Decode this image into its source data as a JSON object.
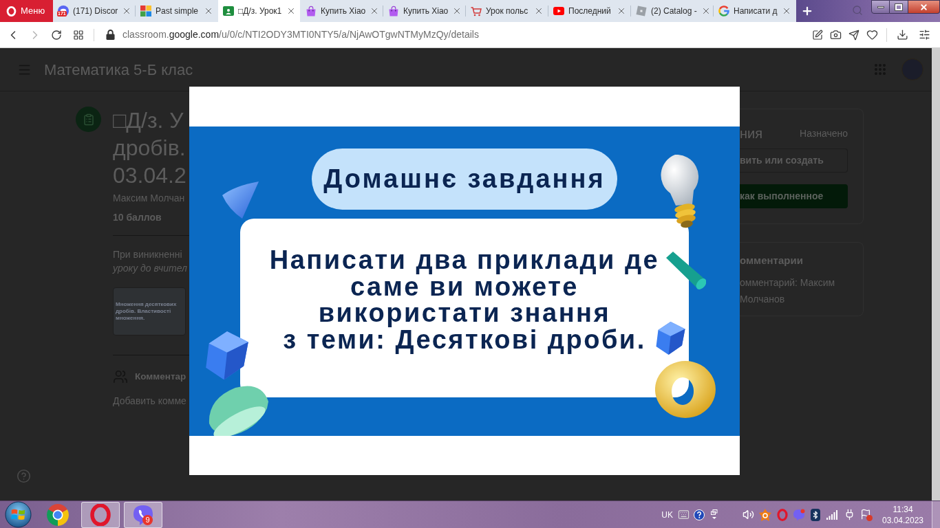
{
  "browser": {
    "menu_label": "Меню",
    "tabs": [
      {
        "kind": "chat",
        "badge": "171",
        "title": "(171) Discor",
        "selected": false
      },
      {
        "kind": "blocks",
        "title": "Past simple",
        "selected": false
      },
      {
        "kind": "board",
        "title": "□Д/з. Урок1",
        "selected": true
      },
      {
        "kind": "bag",
        "title": "Купить Xiao",
        "selected": false
      },
      {
        "kind": "bag",
        "title": "Купить Xiao",
        "selected": false
      },
      {
        "kind": "cart",
        "title": "Урок польс",
        "selected": false
      },
      {
        "kind": "play",
        "title": "Последний",
        "selected": false
      },
      {
        "kind": "tile",
        "title": "(2) Catalog -",
        "selected": false
      },
      {
        "kind": "letter",
        "title": "Написати д",
        "selected": false
      }
    ],
    "navigation": {
      "back_disabled": false,
      "forward_disabled": true
    },
    "address": {
      "subdomain": "classroom.",
      "domain": "google.com",
      "path": "/u/0/c/NTI2ODY3MTI0NTY5/a/NjAwOTgwNTMyMzQy/details"
    }
  },
  "page": {
    "course_title": "Математика 5-Б клас",
    "assignment": {
      "title_lines": [
        "□Д/з. У",
        "дробів.",
        "03.04.2"
      ],
      "author": "Максим Молчан",
      "points": "10 баллов",
      "description_lines": [
        {
          "text": "При виникненні",
          "italic": false
        },
        {
          "text": "уроку до вчител",
          "italic": true
        }
      ],
      "attachment_title": "Множення десяткових дробів. Властивості множення.",
      "comments_heading": "Комментар",
      "add_comment_link": "Добавить комме"
    },
    "side": {
      "work_title": "ния",
      "status": "Назначено",
      "add_button": "вить или создать",
      "done_button": "как выполненное",
      "private_comments_title": "омментарии",
      "private_comment_link": "омментарий: Максим Молчанов"
    }
  },
  "dialog": {
    "slide": {
      "heading": "Домашнє завдання",
      "body_lines": [
        "Написати два приклади де",
        "саме ви можете",
        "використати знання",
        "з теми: Десяткові дроби."
      ]
    }
  },
  "taskbar": {
    "apps": [
      {
        "kind": "browser",
        "running": false
      },
      {
        "kind": "ring",
        "running": true
      },
      {
        "kind": "messenger",
        "running": true,
        "badge": "9"
      }
    ],
    "language": "UK",
    "time": "11:34",
    "date": "03.04.2023"
  }
}
